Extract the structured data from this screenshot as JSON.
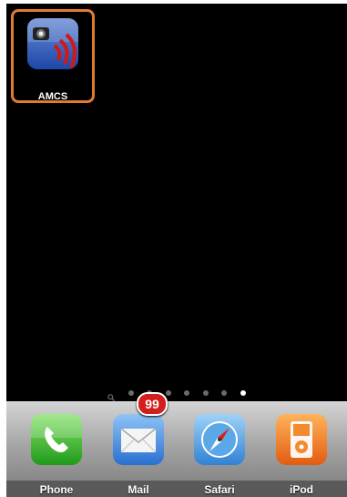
{
  "home": {
    "apps": [
      {
        "label": "AMCS",
        "icon": "amcs-app-icon",
        "selected": true
      }
    ],
    "page_indicator": {
      "pages": 7,
      "current": 7,
      "has_search_page": true
    }
  },
  "dock": {
    "apps": [
      {
        "label": "Phone",
        "icon": "phone-icon"
      },
      {
        "label": "Mail",
        "icon": "mail-icon",
        "badge": "99"
      },
      {
        "label": "Safari",
        "icon": "safari-icon"
      },
      {
        "label": "iPod",
        "icon": "ipod-icon"
      }
    ]
  },
  "colors": {
    "selection_border": "#e47a2e",
    "badge": "#d21e1e",
    "screen_background": "#000000"
  }
}
